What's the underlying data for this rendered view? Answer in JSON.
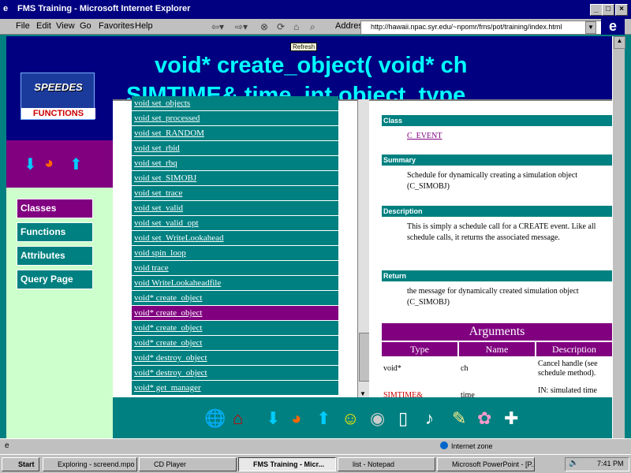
{
  "window": {
    "title": "FMS Training - Microsoft Internet Explorer"
  },
  "menu": {
    "items": [
      "File",
      "Edit",
      "View",
      "Go",
      "Favorites",
      "Help"
    ]
  },
  "toolbar": {
    "address_label": "Address",
    "address": "http://hawaii.npac.syr.edu/~npomr/fms/pot/training/index.html",
    "refresh_tooltip": "Refresh"
  },
  "page": {
    "heading_line1": "void* create_object( void* ch",
    "heading_line2": "SIMTIME& time, int object_type",
    "logo": {
      "title": "SPEEDES",
      "caption": "FUNCTIONS"
    },
    "sidebar": [
      "Classes",
      "Functions",
      "Attributes",
      "Query Page"
    ],
    "methods": [
      "void set_objects",
      "void set_processed",
      "void set_RANDOM",
      "void set_rbid",
      "void set_rbq",
      "void set_SIMOBJ",
      "void set_trace",
      "void set_valid",
      "void set_valid_opt",
      "void set_WriteLookahead",
      "void spin_loop",
      "void trace",
      "void WriteLookaheadfile",
      "void* create_object",
      "void* create_object",
      "void* create_object",
      "void* create_object",
      "void* destroy_object",
      "void* destroy_object",
      "void* get_manager"
    ],
    "selected_index": 14,
    "detail": {
      "class_label": "Class",
      "class_value": "C_EVENT",
      "summary_label": "Summary",
      "summary_text": "Schedule for dynamically creating a simulation object (C_SIMOBJ)",
      "description_label": "Description",
      "description_text": "This is simply a schedule call for a CREATE event. Like all schedule calls, it returns the associated message.",
      "return_label": "Return",
      "return_text": "the message for dynamically created simulation object (C_SIMOBJ)",
      "arguments_title": "Arguments",
      "arg_columns": [
        "Type",
        "Name",
        "Description"
      ],
      "args": [
        {
          "type": "void*",
          "name": "ch",
          "description": "Cancel handle (see schedule method)."
        },
        {
          "type": "SIMTIME&",
          "name": "time",
          "description": "IN: simulated time"
        }
      ]
    }
  },
  "status": {
    "zone": "Internet zone"
  },
  "taskbar": {
    "start": "Start",
    "tasks": [
      "Exploring - screend.mpo",
      "CD Player",
      "FMS Training - Micr...",
      "list - Notepad",
      "Microsoft PowerPoint - [P..."
    ],
    "clock": "7:41 PM"
  }
}
